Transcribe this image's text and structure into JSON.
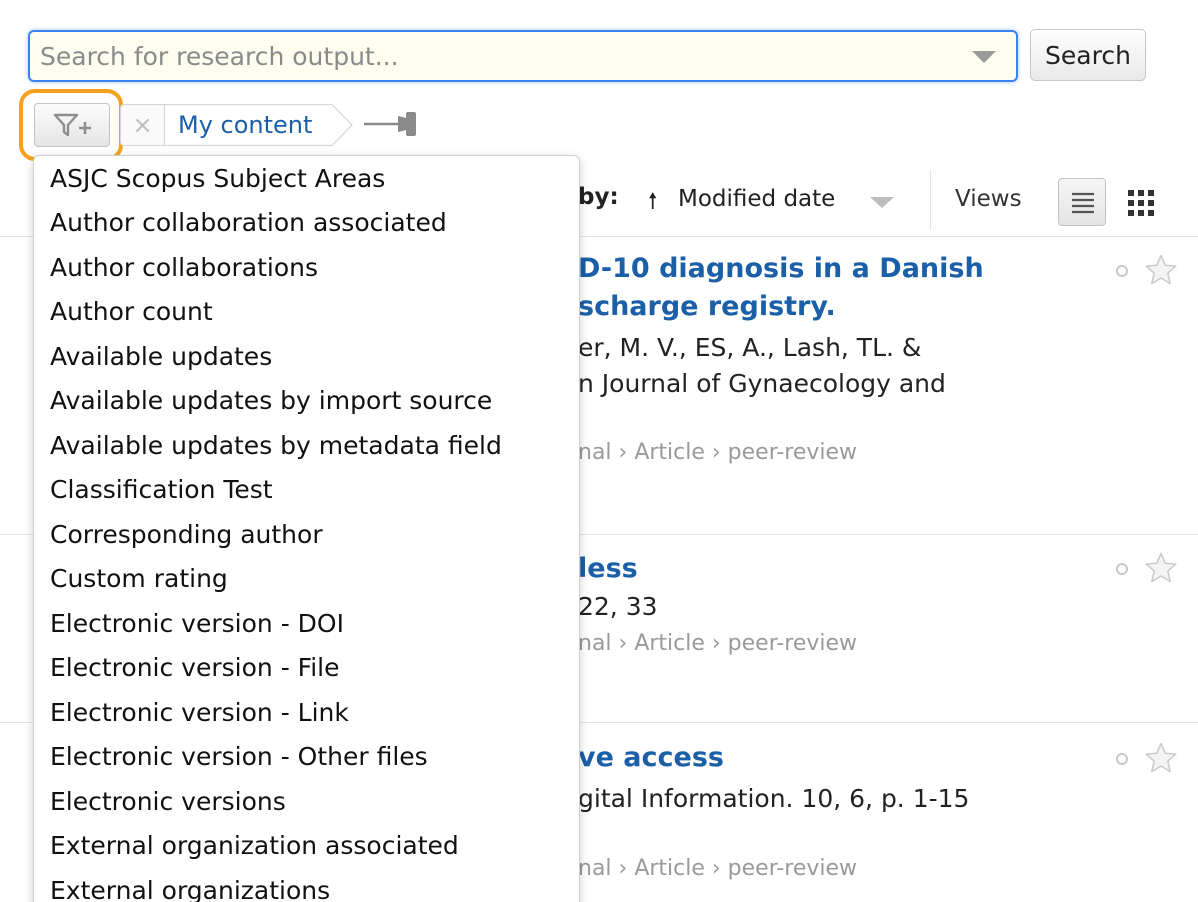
{
  "search": {
    "placeholder": "Search for research output...",
    "button_label": "Search"
  },
  "filter_bar": {
    "add_filter_icon": "filter-plus-icon",
    "remove_icon": "close-icon",
    "breadcrumb_label": "My content",
    "pin_icon": "pin-icon",
    "highlight_color": "#f5a11e"
  },
  "list_header": {
    "sort_label": "by:",
    "sort_direction_icon": "arrow-up-icon",
    "sort_field": "Modified date",
    "views_label": "Views",
    "view_list_icon": "list-view-icon",
    "view_grid_icon": "grid-view-icon"
  },
  "results": [
    {
      "title_lines": [
        "D-10 diagnosis in a Danish",
        "scharge registry."
      ],
      "authors": "er, M. V., ES, A., Lash, TL. &",
      "journal": "n Journal of Gynaecology and",
      "type": "nal › Article › peer-review"
    },
    {
      "title_lines": [
        "less"
      ],
      "journal": "22, 33",
      "type": "nal › Article › peer-review"
    },
    {
      "title_lines": [
        "ve access"
      ],
      "journal": "gital Information. 10, 6, p. 1-15",
      "type": "nal › Article › peer-review"
    }
  ],
  "filter_menu": {
    "items": [
      "ASJC Scopus Subject Areas",
      "Author collaboration associated",
      "Author collaborations",
      "Author count",
      "Available updates",
      "Available updates by import source",
      "Available updates by metadata field",
      "Classification Test",
      "Corresponding author",
      "Custom rating",
      "Electronic version - DOI",
      "Electronic version - File",
      "Electronic version - Link",
      "Electronic version - Other files",
      "Electronic versions",
      "External organization associated",
      "External organizations"
    ]
  }
}
